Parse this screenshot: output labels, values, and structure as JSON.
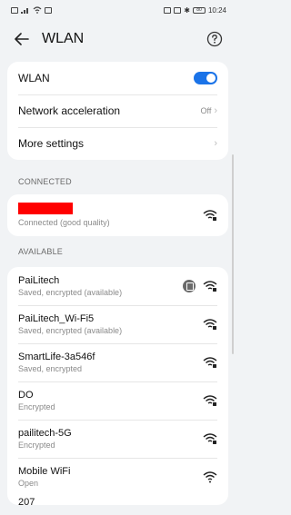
{
  "status_bar": {
    "left_icons": [
      "notification-icon",
      "signal-icon",
      "wifi-icon",
      "message-icon"
    ],
    "right_icons": [
      "nfc-icon",
      "vibrate-icon",
      "bluetooth-icon",
      "battery-icon"
    ],
    "battery": "80",
    "time": "10:24"
  },
  "header": {
    "title": "WLAN"
  },
  "settings": {
    "wlan_label": "WLAN",
    "wlan_on": true,
    "accel_label": "Network acceleration",
    "accel_value": "Off",
    "more_label": "More settings"
  },
  "connected": {
    "section": "CONNECTED",
    "status": "Connected (good quality)"
  },
  "available": {
    "section": "AVAILABLE",
    "networks": [
      {
        "name": "PaiLitech",
        "status": "Saved, encrypted (available)"
      },
      {
        "name": "PaiLitech_Wi-Fi5",
        "status": "Saved, encrypted (available)"
      },
      {
        "name": "SmartLife-3a546f",
        "status": "Saved, encrypted"
      },
      {
        "name": "DO",
        "status": "Encrypted"
      },
      {
        "name": "pailitech-5G",
        "status": "Encrypted"
      },
      {
        "name": "Mobile WiFi",
        "status": "Open"
      },
      {
        "name": "207",
        "status": ""
      }
    ]
  },
  "colors": {
    "accent": "#1a73e8",
    "background": "#f1f3f5",
    "redaction": "#ff0000"
  }
}
